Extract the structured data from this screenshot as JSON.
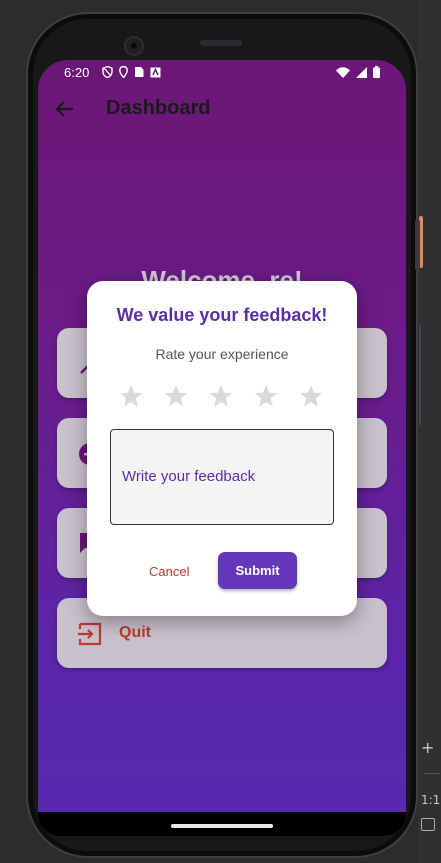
{
  "status_bar": {
    "time": "6:20",
    "left_icons": [
      "shield-icon",
      "location-icon",
      "sim-icon",
      "app-icon"
    ],
    "right_icons": [
      "wifi-icon",
      "signal-icon",
      "battery-icon"
    ]
  },
  "app_bar": {
    "title": "Dashboard",
    "back_icon": "arrow-back-icon"
  },
  "welcome_text": "Welcome, re!",
  "menu": [
    {
      "label": "",
      "icon": "magic-wand-icon"
    },
    {
      "label": "",
      "icon": "info-circle-icon"
    },
    {
      "label": "",
      "icon": "feedback-icon"
    },
    {
      "label": "Quit",
      "icon": "logout-icon",
      "color": "#c0392b"
    }
  ],
  "dialog": {
    "title": "We value your feedback!",
    "subtitle": "Rate your experience",
    "rating": 0,
    "max_rating": 5,
    "feedback_placeholder": "Write your feedback",
    "cancel_label": "Cancel",
    "submit_label": "Submit"
  },
  "emulator_sidebar": {
    "zoom_label": "1:1",
    "plus_label": "+"
  },
  "colors": {
    "accent": "#5b2ea6",
    "submit_button": "#6537b9",
    "cancel_text": "#c0392b",
    "background_top": "#6b1776",
    "background_bottom": "#5629b0",
    "star_empty": "#d9d9d9"
  }
}
